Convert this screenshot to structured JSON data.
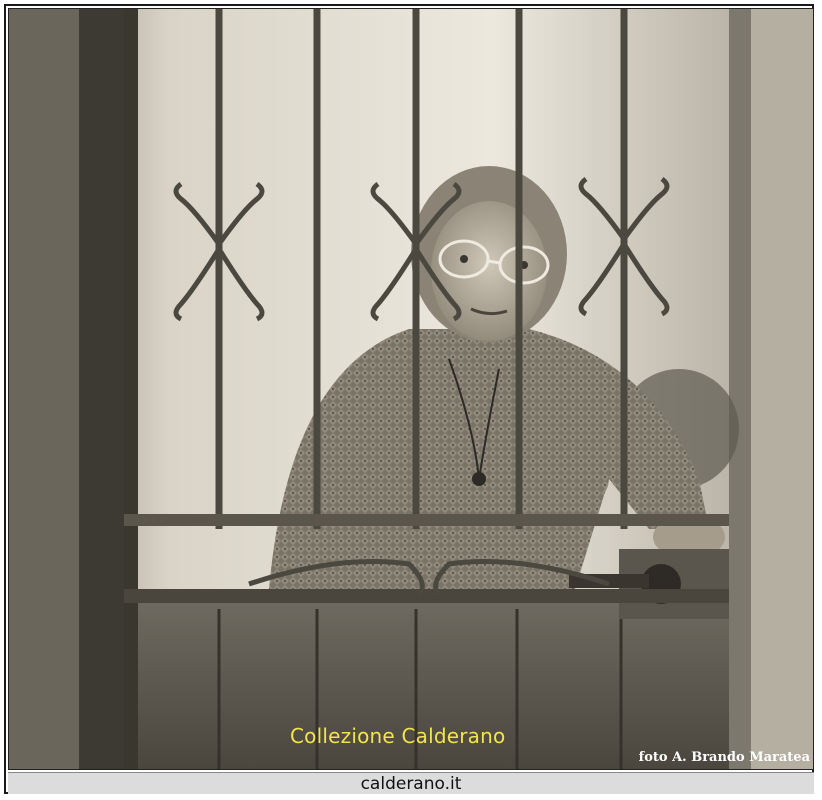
{
  "photo": {
    "subject": "elderly-woman-behind-iron-gate",
    "tone": "sepia"
  },
  "caption": {
    "text": "Collezione Calderano",
    "color": "#f2e44a"
  },
  "credit": {
    "text": "foto A. Brando Maratea"
  },
  "site": {
    "text": "calderano.it"
  }
}
